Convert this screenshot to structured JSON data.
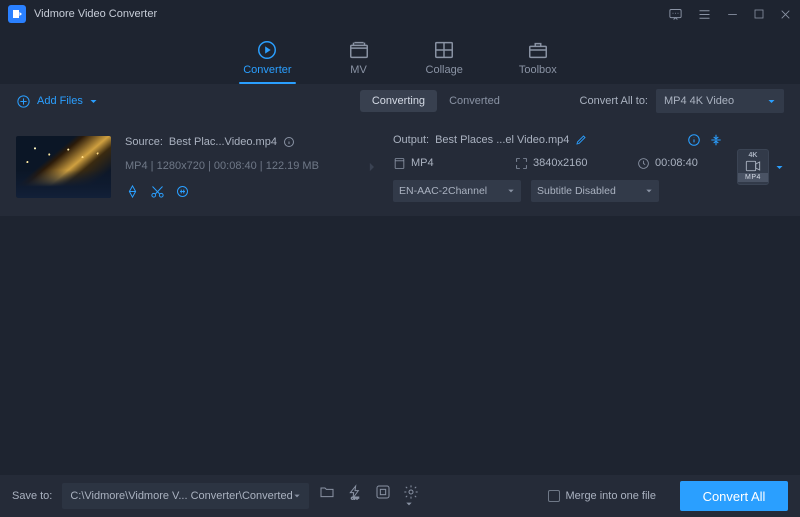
{
  "app": {
    "title": "Vidmore Video Converter"
  },
  "tabs": [
    {
      "label": "Converter",
      "active": true
    },
    {
      "label": "MV"
    },
    {
      "label": "Collage"
    },
    {
      "label": "Toolbox"
    }
  ],
  "toolbar": {
    "add_files": "Add Files",
    "seg": {
      "converting": "Converting",
      "converted": "Converted"
    },
    "convert_all_label": "Convert All to:",
    "format": "MP4 4K Video"
  },
  "item": {
    "source_label": "Source:",
    "source_name": "Best Plac...Video.mp4",
    "meta": {
      "container": "MP4",
      "resolution": "1280x720",
      "duration": "00:08:40",
      "size": "122.19 MB"
    },
    "output_label": "Output:",
    "output_name": "Best Places ...el Video.mp4",
    "out": {
      "container": "MP4",
      "resolution": "3840x2160",
      "duration": "00:08:40"
    },
    "audio_select": "EN-AAC-2Channel",
    "subtitle_select": "Subtitle Disabled",
    "thumb_badge": "4K",
    "thumb_label": "MP4"
  },
  "footer": {
    "save_to_label": "Save to:",
    "path": "C:\\Vidmore\\Vidmore V... Converter\\Converted",
    "merge_label": "Merge into one file",
    "convert_label": "Convert All"
  }
}
